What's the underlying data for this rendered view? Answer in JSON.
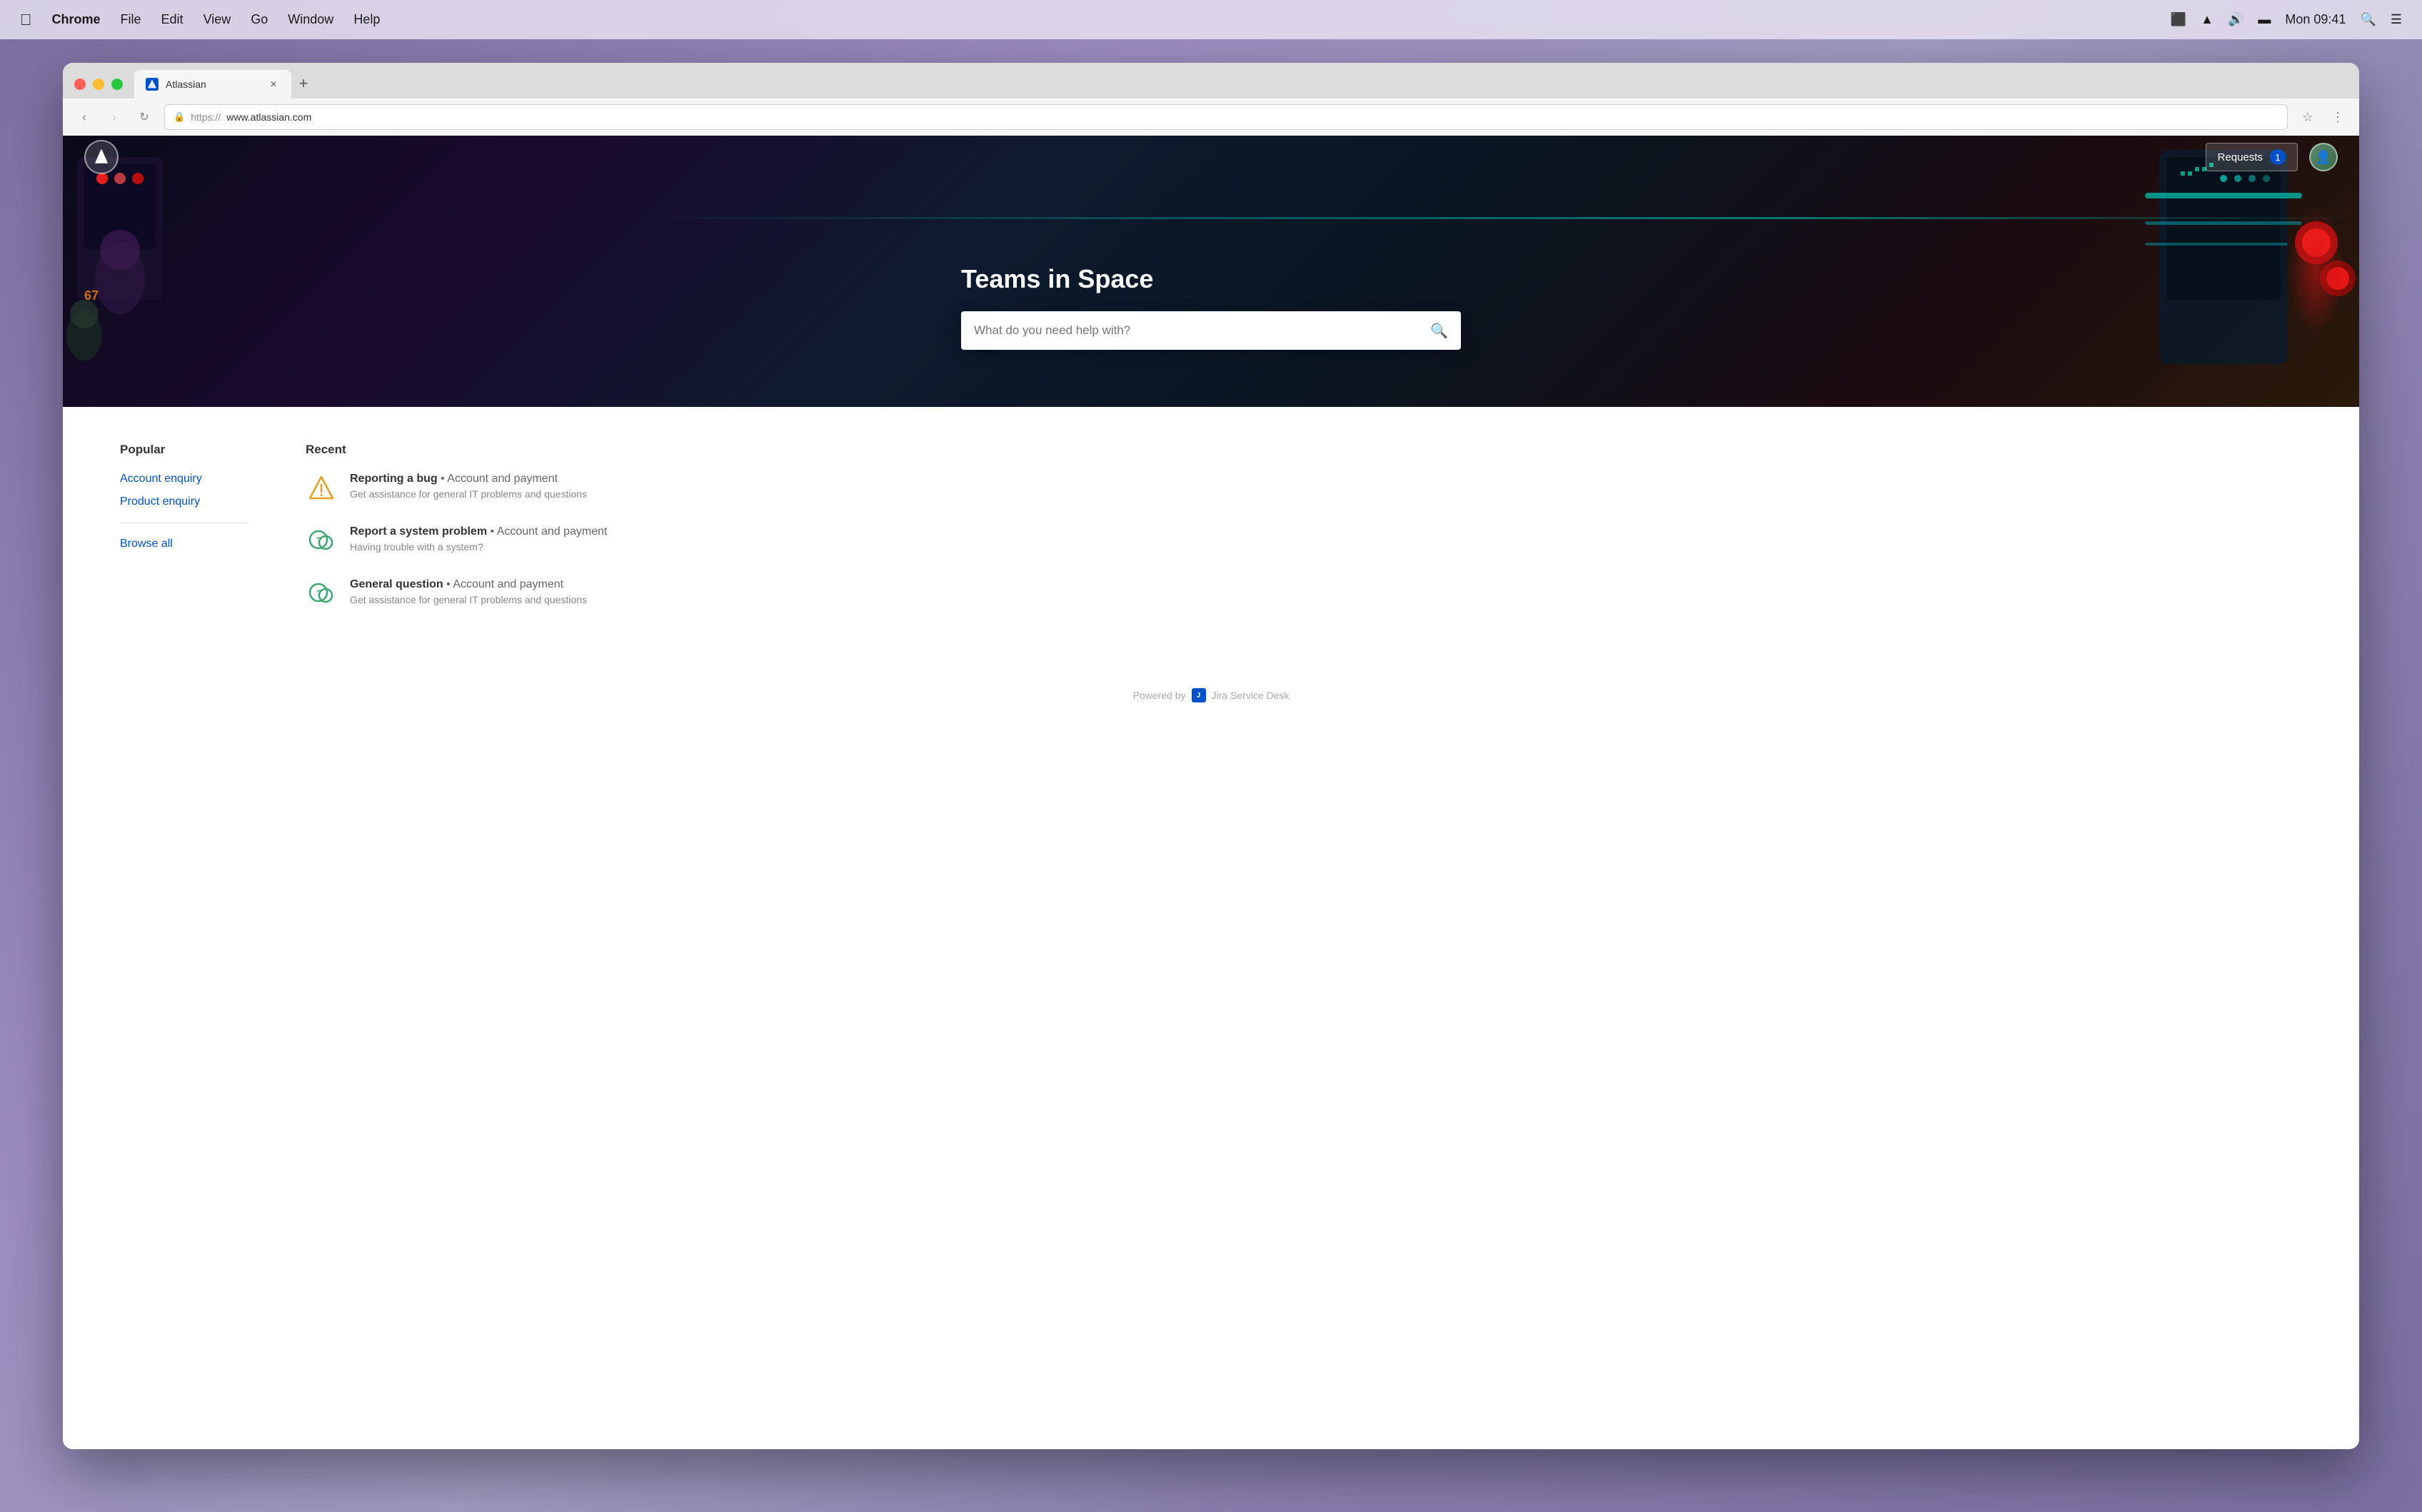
{
  "menubar": {
    "apple_icon": "🍎",
    "app_name": "Chrome",
    "menu_items": [
      "File",
      "Edit",
      "View",
      "Go",
      "Window",
      "Help"
    ],
    "time": "Mon 09:41"
  },
  "browser": {
    "tab": {
      "title": "Atlassian",
      "favicon_alt": "atlassian-favicon"
    },
    "new_tab_icon": "+",
    "nav": {
      "back": "‹",
      "forward": "›",
      "reload": "↻"
    },
    "url": {
      "scheme": "https://",
      "domain": "www.atlassian.com"
    }
  },
  "hero": {
    "title": "Teams in Space",
    "search_placeholder": "What do you need help with?",
    "nav": {
      "requests_label": "Requests",
      "requests_count": "1"
    }
  },
  "popular": {
    "section_title": "Popular",
    "links": [
      {
        "label": "Account enquiry"
      },
      {
        "label": "Product enquiry"
      }
    ],
    "browse_all": "Browse all"
  },
  "recent": {
    "section_title": "Recent",
    "items": [
      {
        "title": "Reporting a bug",
        "category": "Account and payment",
        "description": "Get assistance for general IT problems and questions",
        "icon_type": "warning"
      },
      {
        "title": "Report a system problem",
        "category": "Account and payment",
        "description": "Having trouble with a system?",
        "icon_type": "question-chat"
      },
      {
        "title": "General question",
        "category": "Account and payment",
        "description": "Get assistance for general IT problems and questions",
        "icon_type": "question-chat"
      }
    ]
  },
  "footer": {
    "powered_by": "Powered by",
    "product_name": "Jira Service Desk"
  }
}
